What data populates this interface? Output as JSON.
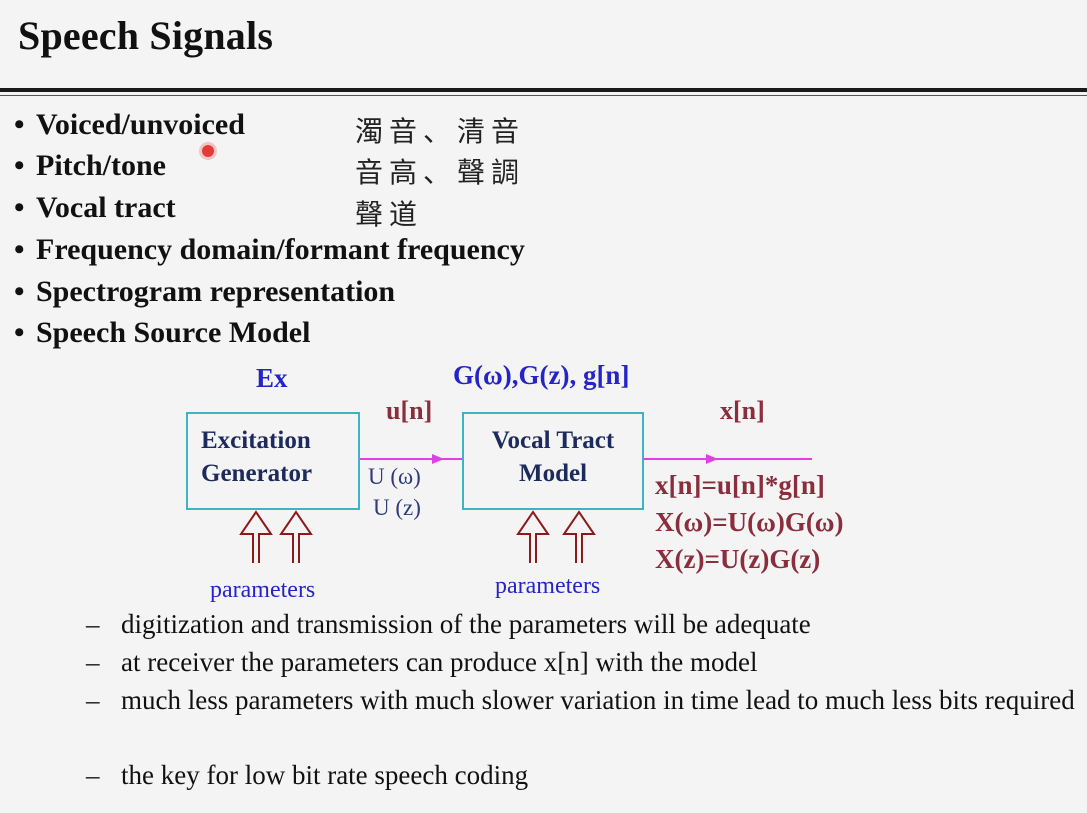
{
  "title": "Speech Signals",
  "bullets": [
    {
      "text": "Voiced/unvoiced",
      "zh": "濁音、清音"
    },
    {
      "text": "Pitch/tone",
      "zh": "音高、聲調"
    },
    {
      "text": "Vocal tract",
      "zh": "聲道"
    },
    {
      "text": "Frequency domain/formant frequency",
      "zh": ""
    },
    {
      "text": "Spectrogram representation",
      "zh": ""
    },
    {
      "text": "Speech Source Model",
      "zh": ""
    }
  ],
  "diagram": {
    "ex_label": "Ex",
    "g_label": "G(ω),G(z), g[n]",
    "un_label": "u[n]",
    "xn_label": "x[n]",
    "excitation_box": [
      "Excitation",
      "Generator"
    ],
    "vocal_box": [
      "Vocal Tract",
      "Model"
    ],
    "u_omega": "U (ω)",
    "u_z": "U (z)",
    "parameters_left": "parameters",
    "parameters_right": "parameters",
    "equations": [
      "x[n]=u[n]*g[n]",
      "X(ω)=U(ω)G(ω)",
      "X(z)=U(z)G(z)"
    ],
    "arrow_color": "#e040e0",
    "param_arrow_color": "#8b1a1a",
    "box_border_color": "#3bb5c6"
  },
  "subbullets": [
    "digitization and transmission of the parameters will be adequate",
    "at receiver the parameters can produce x[n] with the model",
    "much less parameters with much slower variation in time lead to much less bits required",
    "the key for low bit rate speech coding"
  ],
  "dash": "–"
}
